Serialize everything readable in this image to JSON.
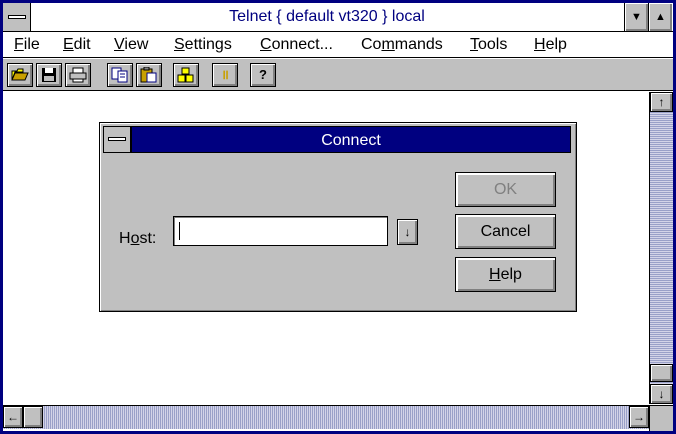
{
  "window": {
    "title": "Telnet { default vt320 } local",
    "minimize_glyph": "▼",
    "maximize_glyph": "▲"
  },
  "menu": [
    {
      "pre": "",
      "key": "F",
      "post": "ile"
    },
    {
      "pre": "",
      "key": "E",
      "post": "dit"
    },
    {
      "pre": "",
      "key": "V",
      "post": "iew"
    },
    {
      "pre": "",
      "key": "S",
      "post": "ettings"
    },
    {
      "pre": "",
      "key": "C",
      "post": "onnect..."
    },
    {
      "pre": "Co",
      "key": "m",
      "post": "mands"
    },
    {
      "pre": "",
      "key": "T",
      "post": "ools"
    },
    {
      "pre": "",
      "key": "H",
      "post": "elp"
    }
  ],
  "toolbar": {
    "open_icon": "folder-open-icon",
    "save_icon": "floppy-disk-icon",
    "print_icon": "printer-icon",
    "copy_icon": "copy-icon",
    "paste_icon": "paste-icon",
    "connect_icon": "blocks-icon",
    "pause_icon": "pause-icon",
    "help_icon": "help-question-icon",
    "help_glyph": "?",
    "pause_glyph": "॥"
  },
  "scrollbars": {
    "up_glyph": "↑",
    "down_glyph": "↓",
    "left_glyph": "←",
    "right_glyph": "→"
  },
  "dialog": {
    "title": "Connect",
    "host_label_pre": "H",
    "host_label_key": "o",
    "host_label_post": "st:",
    "host_value": "",
    "dropdown_glyph": "↓",
    "ok_label": "OK",
    "cancel_label": "Cancel",
    "help_label_key": "H",
    "help_label_post": "elp"
  },
  "colors": {
    "title_text": "#000080",
    "dialog_caption": "#000080",
    "face": "#c0c0c0"
  }
}
